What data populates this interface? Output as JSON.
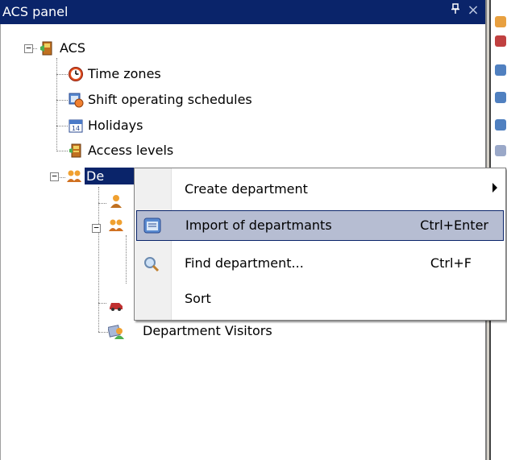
{
  "panel": {
    "title": "ACS panel",
    "pin_glyph": "д",
    "close_glyph": "×"
  },
  "tree": {
    "root": {
      "label": "ACS",
      "icon": "acs-icon",
      "expander": "−"
    },
    "items": [
      {
        "label": "Time zones",
        "icon": "clock-icon"
      },
      {
        "label": "Shift operating schedules",
        "icon": "schedule-icon"
      },
      {
        "label": "Holidays",
        "icon": "calendar-icon"
      },
      {
        "label": "Access levels",
        "icon": "access-level-icon"
      }
    ],
    "departments": {
      "label": "De",
      "icon": "people-icon",
      "expander": "−"
    },
    "sub_expander": "−",
    "visitors": {
      "label": "Department Visitors",
      "icon": "visitors-icon"
    }
  },
  "context_menu": {
    "items": [
      {
        "label": "Create department",
        "shortcut": "",
        "has_submenu": true,
        "icon": ""
      },
      {
        "label": "Import of departmants",
        "shortcut": "Ctrl+Enter",
        "highlighted": true,
        "icon": "import-icon"
      },
      {
        "label": "Find department...",
        "shortcut": "Ctrl+F",
        "icon": "search-icon"
      },
      {
        "label": "Sort",
        "shortcut": "",
        "icon": ""
      }
    ]
  },
  "colors": {
    "titlebar": "#0a246a",
    "selection": "#0a246a",
    "menu_highlight": "#b6bdd2"
  }
}
